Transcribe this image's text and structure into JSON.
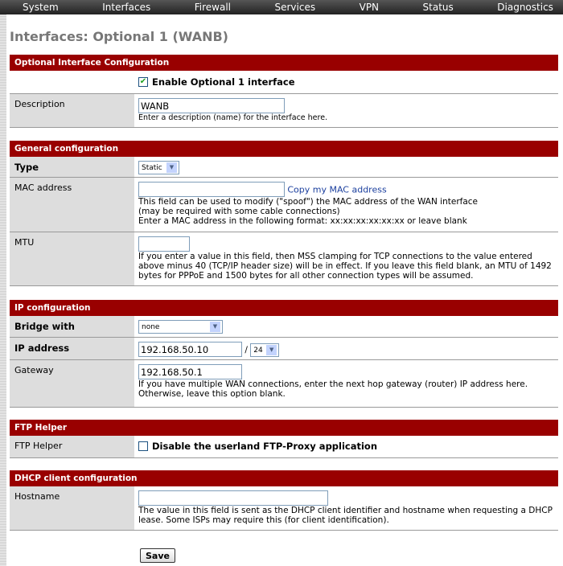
{
  "nav": [
    "System",
    "Interfaces",
    "Firewall",
    "Services",
    "VPN",
    "Status",
    "Diagnostics"
  ],
  "title": "Interfaces: Optional 1 (WANB)",
  "sections": {
    "optional": {
      "header": "Optional Interface Configuration",
      "enable_label": "Enable Optional 1 interface",
      "enable_checked": true,
      "description_label": "Description",
      "description_value": "WANB",
      "description_help": "Enter a description (name) for the interface here."
    },
    "general": {
      "header": "General configuration",
      "type_label": "Type",
      "type_value": "Static",
      "mac_label": "MAC address",
      "mac_value": "",
      "mac_link": "Copy my MAC address",
      "mac_help1": "This field can be used to modify (\"spoof\") the MAC address of the WAN interface",
      "mac_help2": "(may be required with some cable connections)",
      "mac_help3": "Enter a MAC address in the following format: xx:xx:xx:xx:xx:xx or leave blank",
      "mtu_label": "MTU",
      "mtu_value": "",
      "mtu_help": "If you enter a value in this field, then MSS clamping for TCP connections to the value entered above minus 40 (TCP/IP header size) will be in effect. If you leave this field blank, an MTU of 1492 bytes for PPPoE and 1500 bytes for all other connection types will be assumed."
    },
    "ip": {
      "header": "IP configuration",
      "bridge_label": "Bridge with",
      "bridge_value": "none",
      "ip_label": "IP address",
      "ip_value": "192.168.50.10",
      "slash": "/",
      "subnet_value": "24",
      "gateway_label": "Gateway",
      "gateway_value": "192.168.50.1",
      "gateway_help": "If you have multiple WAN connections, enter the next hop gateway (router) IP address here. Otherwise, leave this option blank."
    },
    "ftp": {
      "header": "FTP Helper",
      "label": "FTP Helper",
      "checkbox_label": "Disable the userland FTP-Proxy application",
      "checked": false
    },
    "dhcp": {
      "header": "DHCP client configuration",
      "hostname_label": "Hostname",
      "hostname_value": "",
      "hostname_help": "The value in this field is sent as the DHCP client identifier and hostname when requesting a DHCP lease. Some ISPs may require this (for client identification)."
    }
  },
  "save_label": "Save"
}
